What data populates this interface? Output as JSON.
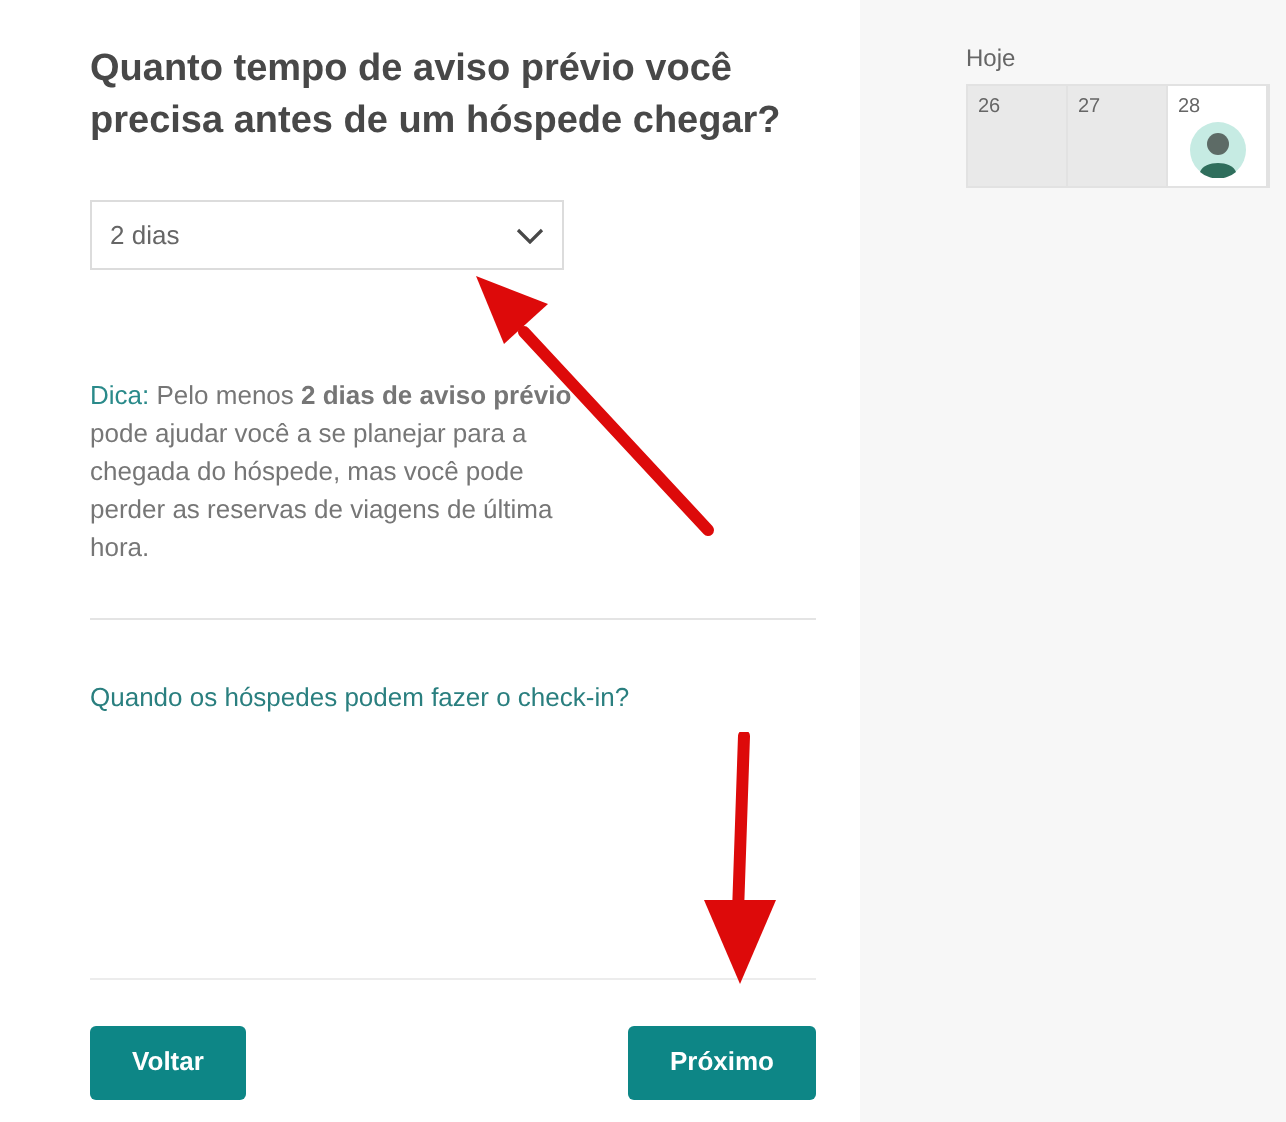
{
  "question": "Quanto tempo de aviso prévio você precisa antes de um hóspede chegar?",
  "select": {
    "value": "2 dias"
  },
  "tip": {
    "label": "Dica:",
    "text": "Pelo menos **2 dias de aviso prévio** pode ajudar você a se planejar para a chegada do hóspede, mas você pode perder as reservas de viagens de última hora."
  },
  "link": "Quando os hóspedes podem fazer o check-in?",
  "buttons": [
    "Voltar",
    "Próximo"
  ],
  "calendar": {
    "label": "Hoje",
    "days": [
      {
        "day": "26",
        "past": true,
        "avatar": false
      },
      {
        "day": "27",
        "past": true,
        "avatar": false
      },
      {
        "day": "28",
        "past": false,
        "avatar": true
      }
    ]
  }
}
